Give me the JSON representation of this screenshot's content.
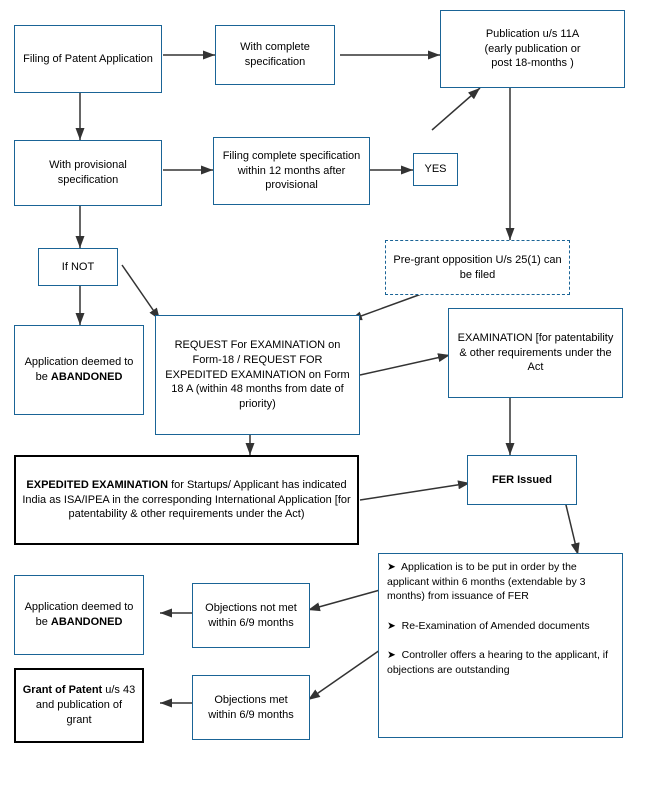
{
  "boxes": {
    "filing": {
      "label": "Filing of Patent Application"
    },
    "complete_spec": {
      "label": "With complete specification"
    },
    "publication": {
      "label": "Publication u/s 11A\n(early publication or\npost 18-months )"
    },
    "provisional_spec": {
      "label": "With provisional specification"
    },
    "filing_complete": {
      "label": "Filing complete specification within 12 months after provisional"
    },
    "yes": {
      "label": "YES"
    },
    "if_not": {
      "label": "If NOT"
    },
    "abandoned1": {
      "label": "Application deemed to be ABANDONED"
    },
    "pre_grant": {
      "label": "Pre-grant opposition U/s 25(1) can be filed"
    },
    "request_exam": {
      "label": "REQUEST For EXAMINATION on Form-18 / REQUEST FOR EXPEDITED EXAMINATION on Form 18 A (within 48 months from date of priority)"
    },
    "examination": {
      "label": "EXAMINATION [for patentability & other requirements under the Act"
    },
    "expedited": {
      "label": "EXPEDITED EXAMINATION for Startups/ Applicant has indicated India as ISA/IPEA in the corresponding International Application [for patentability & other requirements under the Act)"
    },
    "fer_issued": {
      "label": "FER Issued"
    },
    "fer_notes": {
      "label": "Application is to be put in order by the applicant within 6 months (extendable by 3 months) from issuance of FER\nRe-Examination of Amended documents\nController offers a hearing to the applicant, if objections are outstanding"
    },
    "objections_not_met": {
      "label": "Objections not met within 6/9 months"
    },
    "abandoned2": {
      "label": "Application deemed to be ABANDONED"
    },
    "objections_met": {
      "label": "Objections met within 6/9 months"
    },
    "grant": {
      "label": "Grant of Patent u/s 43 and publication of grant"
    },
    "yes_label": "YES",
    "if_not_label": "If NOT"
  }
}
